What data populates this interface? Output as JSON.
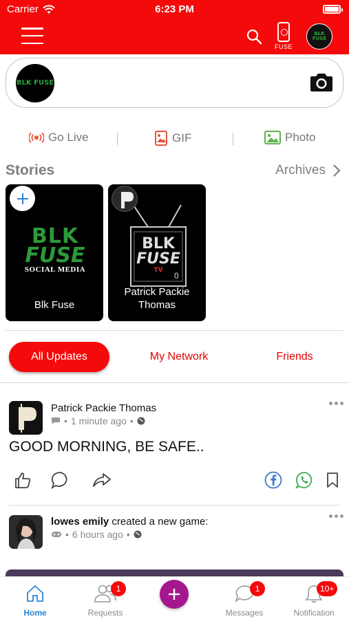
{
  "status_bar": {
    "carrier": "Carrier",
    "time": "6:23 PM"
  },
  "header": {
    "fuse_label": "FUSE",
    "avatar_logo": "BLK FUSE"
  },
  "composer": {
    "avatar_logo": "BLK FUSE"
  },
  "actions": [
    {
      "label": "Go Live",
      "icon": "broadcast-icon",
      "color": "#f0533a"
    },
    {
      "label": "GIF",
      "icon": "gif-image-icon",
      "color": "#e2533d"
    },
    {
      "label": "Photo",
      "icon": "photo-icon",
      "color": "#5fb24a"
    }
  ],
  "stories": {
    "title": "Stories",
    "archives_label": "Archives",
    "items": [
      {
        "name": "Blk Fuse",
        "logo_line1": "BLK",
        "logo_line2": "FUSE",
        "logo_line3": "SOCIAL MEDIA"
      },
      {
        "name_line1": "Patrick Packie",
        "name_line2": "Thomas",
        "tv_line1": "BLK",
        "tv_line2": "FUSE",
        "tv_line3": "TV",
        "tv_mark": "0"
      }
    ]
  },
  "feed_tabs": {
    "active": "All Updates",
    "second": "My Network",
    "third": "Friends"
  },
  "posts": [
    {
      "author": "Patrick Packie Thomas",
      "time": "1 minute ago",
      "body": "GOOD MORNING, BE SAFE.."
    },
    {
      "author": "lowes emily",
      "action": "created a new game:",
      "time": "6 hours ago"
    }
  ],
  "bottom_nav": {
    "home": "Home",
    "requests": "Requests",
    "requests_badge": "1",
    "messages": "Messages",
    "messages_badge": "1",
    "notification": "Notification",
    "notification_badge": "10+"
  },
  "colors": {
    "brand_red": "#f40a0a",
    "fab_purple": "#a5178f",
    "active_blue": "#2b83d6"
  }
}
